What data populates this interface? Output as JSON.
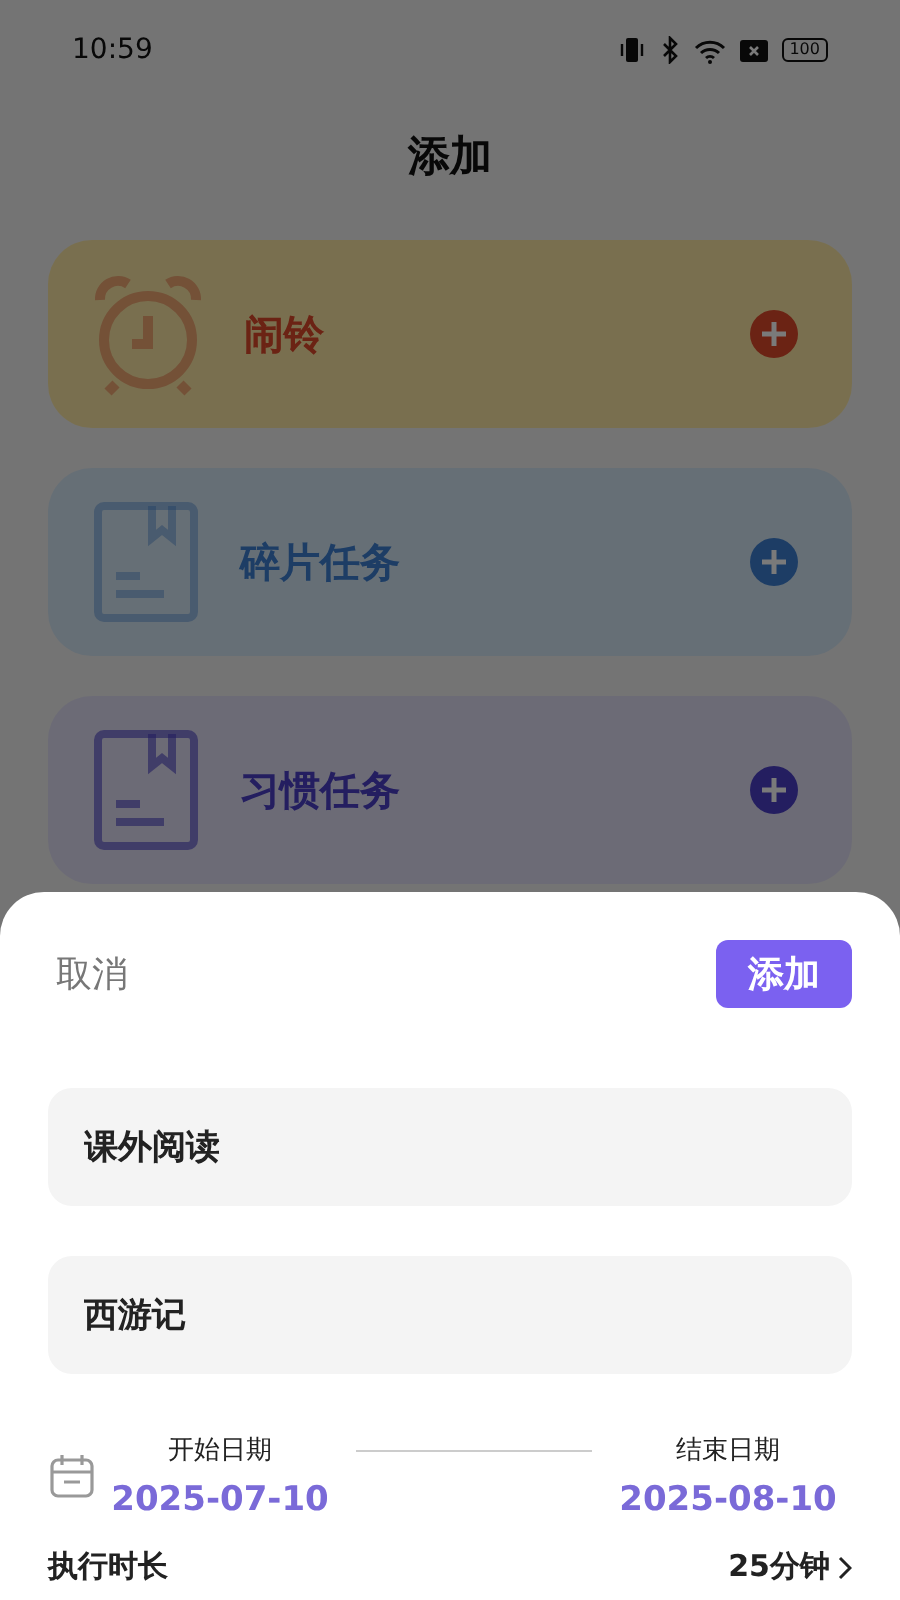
{
  "status_bar": {
    "time": "10:59",
    "battery": "100"
  },
  "title": "添加",
  "categories": [
    {
      "label": "闹铃",
      "kind": "alarm"
    },
    {
      "label": "碎片任务",
      "kind": "fragment"
    },
    {
      "label": "习惯任务",
      "kind": "habit"
    }
  ],
  "sheet": {
    "cancel": "取消",
    "add": "添加",
    "fields": [
      {
        "value": "课外阅读"
      },
      {
        "value": "西游记"
      }
    ],
    "start_date": {
      "label": "开始日期",
      "value": "2025-07-10"
    },
    "end_date": {
      "label": "结束日期",
      "value": "2025-08-10"
    },
    "duration": {
      "label": "执行时长",
      "value": "25分钟"
    }
  }
}
